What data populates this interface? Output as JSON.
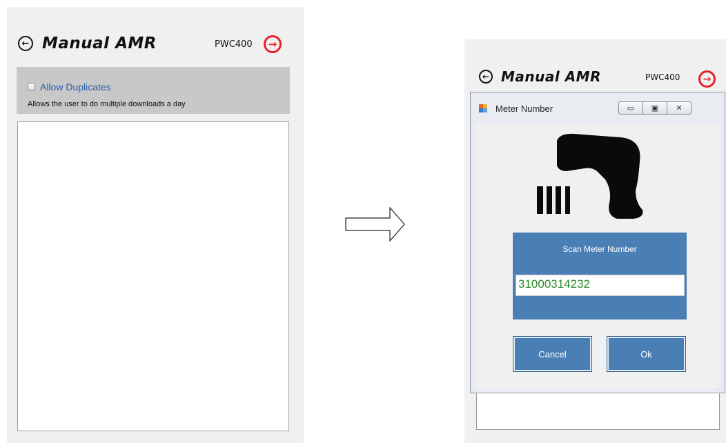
{
  "left_screen": {
    "title": "Manual AMR",
    "code": "PWC400",
    "allow_duplicates": {
      "label": "Allow Duplicates",
      "description": "Allows the user to do multiple downloads a day",
      "checked": false
    }
  },
  "right_screen": {
    "title": "Manual AMR",
    "code": "PWC400"
  },
  "dialog": {
    "title": "Meter Number",
    "window_buttons": [
      "minimize",
      "restore",
      "close"
    ],
    "scan_label": "Scan Meter Number",
    "meter_number": "31000314232",
    "cancel_label": "Cancel",
    "ok_label": "Ok"
  },
  "icons": {
    "back": "back-arrow-circle-icon",
    "next": "next-arrow-circle-icon",
    "scanner": "barcode-scanner-icon",
    "transition": "right-arrow-icon"
  },
  "colors": {
    "accent_red": "#e8202c",
    "panel_blue": "#4a7fb5",
    "input_text_green": "#2c8a2c",
    "option_bar_gray": "#c8c8c8",
    "checkbox_label_blue": "#2c5ea8"
  }
}
